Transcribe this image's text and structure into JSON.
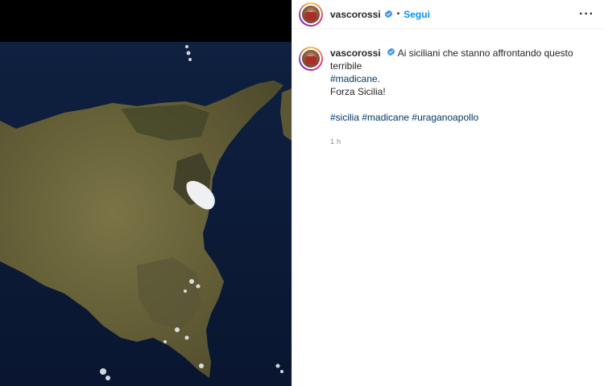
{
  "post": {
    "username": "vascorossi",
    "follow_label": "Segui",
    "separator": "•",
    "more_label": "···",
    "caption": {
      "text_before": "Ai siciliani che stanno affrontando questo terribile",
      "hashtag_inline": "#madicane.",
      "line2": "Forza Sicilia!",
      "tags": [
        "#sicilia",
        "#madicane",
        "#uraganoapollo"
      ]
    },
    "timestamp": "1 h"
  },
  "icons": {
    "verified": "verified-badge-icon",
    "more": "more-options-icon"
  },
  "colors": {
    "link_blue": "#0095f6",
    "hashtag": "#00376b",
    "sea": "#0c1a33",
    "land": "#6b6a3e"
  }
}
